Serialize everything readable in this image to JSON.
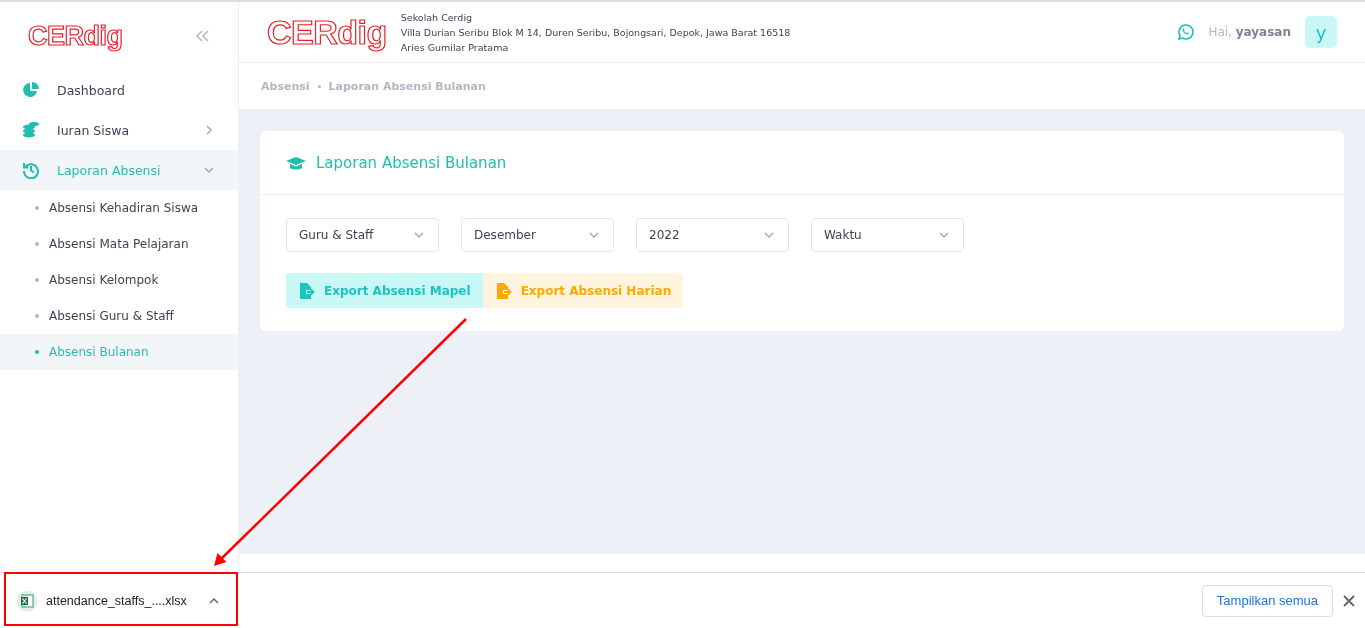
{
  "sidebar": {
    "logo": "CERdig",
    "menu": [
      {
        "kind": "dashboard",
        "label": "Dashboard",
        "selected": false
      },
      {
        "kind": "coins",
        "label": "Iuran Siswa",
        "expanded": false,
        "selected": false
      },
      {
        "kind": "history",
        "label": "Laporan Absensi",
        "expanded": true,
        "selected": true,
        "children": [
          {
            "label": "Absensi Kehadiran Siswa",
            "selected": false
          },
          {
            "label": "Absensi Mata Pelajaran",
            "selected": false
          },
          {
            "label": "Absensi Kelompok",
            "selected": false
          },
          {
            "label": "Absensi Guru & Staff",
            "selected": false
          },
          {
            "label": "Absensi Bulanan",
            "selected": true
          }
        ]
      }
    ]
  },
  "header": {
    "logo": "CERdig",
    "school_name": "Sekolah Cerdig",
    "address": "Villa Durian Seribu Blok M 14, Duren Seribu, Bojongsari, Depok, Jawa Barat 16518",
    "person": "Aries Gumilar Pratama",
    "greeting": "Hai, **yayasan**",
    "avatar": "y"
  },
  "breadcrumb": [
    "Absensi",
    "Laporan Absensi Bulanan"
  ],
  "card": {
    "title": "Laporan Absensi Bulanan",
    "filters": [
      {
        "value": "Guru & Staff"
      },
      {
        "value": "Desember"
      },
      {
        "value": "2022"
      },
      {
        "value": "Waktu"
      }
    ],
    "buttons": [
      {
        "label": "Export Absensi Mapel",
        "kind": "teal"
      },
      {
        "label": "Export Absensi Harian",
        "kind": "orange"
      }
    ]
  },
  "download_bar": {
    "file": "attendance_staffs_....xlsx",
    "show_all": "Tampilkan semua"
  }
}
